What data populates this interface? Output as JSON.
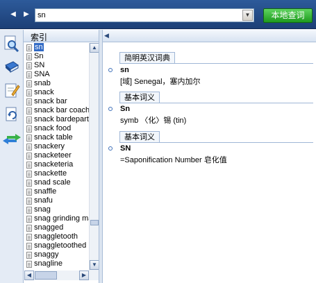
{
  "toolbar": {
    "search_value": "sn",
    "lookup_button": "本地查词"
  },
  "index_panel": {
    "title": "索引",
    "words": [
      "sn",
      "Sn",
      "SN",
      "SNA",
      "snab",
      "snack",
      "snack bar",
      "snack bar coach",
      "snack bardepartment",
      "snack food",
      "snack table",
      "snackery",
      "snacketeer",
      "snacketeria",
      "snackette",
      "snad scale",
      "snaffle",
      "snafu",
      "snag",
      "snag grinding machine",
      "snagged",
      "snaggletooth",
      "snaggletoothed",
      "snaggy",
      "snagline"
    ],
    "selected_index": 0
  },
  "sections": [
    {
      "tab": "简明英汉词典",
      "headword": "sn",
      "meaning": "[域] Senegal，塞内加尔"
    },
    {
      "tab": "基本词义",
      "headword": "Sn",
      "meaning": "symb 〈化〉锡 (tin)"
    },
    {
      "tab": "基本词义",
      "headword": "SN",
      "meaning": "=Saponification Number 皂化值"
    }
  ],
  "colors": {
    "topbar": "#2d5a9a",
    "lookup_button": "#2fb02f",
    "selection": "#316ac5"
  }
}
